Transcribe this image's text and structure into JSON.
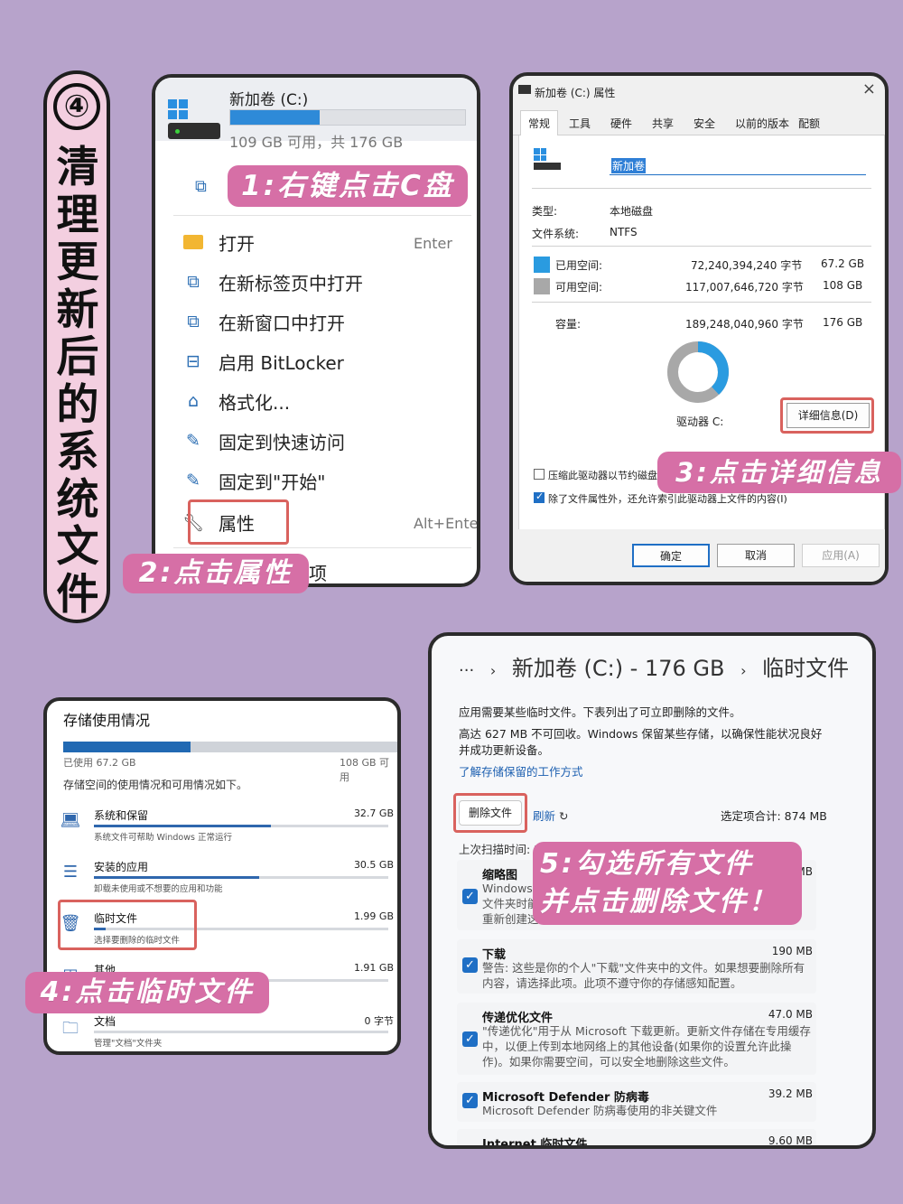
{
  "title": {
    "number": "④",
    "text": "清理更新后的系统文件"
  },
  "context_menu": {
    "drive_name": "新加卷 (C:)",
    "drive_free": "109 GB 可用，共 176 GB",
    "drive_used_fraction": 0.38,
    "items": [
      {
        "label": "打开",
        "shortcut": "Enter",
        "icon": "folder-icon"
      },
      {
        "label": "在新标签页中打开",
        "shortcut": "",
        "icon": "new-tab-icon"
      },
      {
        "label": "在新窗口中打开",
        "shortcut": "",
        "icon": "new-window-icon"
      },
      {
        "label": "启用 BitLocker",
        "shortcut": "",
        "icon": "bitlocker-icon"
      },
      {
        "label": "格式化...",
        "shortcut": "",
        "icon": "format-icon"
      },
      {
        "label": "固定到快速访问",
        "shortcut": "",
        "icon": "pin-icon"
      },
      {
        "label": "固定到\"开始\"",
        "shortcut": "",
        "icon": "pin-start-icon"
      },
      {
        "label": "属性",
        "shortcut": "Alt+Enter",
        "icon": "wrench-icon"
      },
      {
        "label": "项",
        "shortcut": "",
        "icon": ""
      }
    ]
  },
  "callouts": {
    "step1": "1:右键点击C盘",
    "step2": "2:点击属性",
    "step3": "3:点击详细信息",
    "step4": "4:点击临时文件",
    "step5_line1": "5:勾选所有文件",
    "step5_line2": "并点击删除文件！"
  },
  "properties": {
    "window_title": "新加卷 (C:) 属性",
    "close": "×",
    "tabs": [
      "常规",
      "工具",
      "硬件",
      "共享",
      "安全",
      "以前的版本",
      "配额"
    ],
    "volume_name": "新加卷",
    "type_label": "类型:",
    "type_value": "本地磁盘",
    "fs_label": "文件系统:",
    "fs_value": "NTFS",
    "used_label": "已用空间:",
    "used_bytes": "72,240,394,240 字节",
    "used_gb": "67.2 GB",
    "free_label": "可用空间:",
    "free_bytes": "117,007,646,720 字节",
    "free_gb": "108 GB",
    "cap_label": "容量:",
    "cap_bytes": "189,248,040,960 字节",
    "cap_gb": "176 GB",
    "drive_label": "驱动器 C:",
    "details_button": "详细信息(D)",
    "compress_label": "压缩此驱动器以节约磁盘",
    "index_label": "除了文件属性外，还允许索引此驱动器上文件的内容(I)",
    "ok": "确定",
    "cancel": "取消",
    "apply": "应用(A)",
    "used_color": "#2a9be0",
    "free_color": "#a8a8a8",
    "used_fraction": 0.38
  },
  "storage": {
    "title": "存储使用情况",
    "used": "已使用 67.2 GB",
    "free": "108 GB 可用",
    "used_fraction": 0.38,
    "desc": "存储空间的使用情况和可用情况如下。",
    "rows": [
      {
        "name": "系统和保留",
        "size": "32.7 GB",
        "desc": "系统文件可帮助 Windows 正常运行",
        "fraction": 0.6,
        "icon": "laptop-icon"
      },
      {
        "name": "安装的应用",
        "size": "30.5 GB",
        "desc": "卸载未使用或不想要的应用和功能",
        "fraction": 0.56,
        "icon": "apps-list-icon"
      },
      {
        "name": "临时文件",
        "size": "1.99 GB",
        "desc": "选择要删除的临时文件",
        "fraction": 0.04,
        "icon": "trash-icon"
      },
      {
        "name": "其他",
        "size": "1.91 GB",
        "desc": "",
        "fraction": 0.035,
        "icon": "other-icon"
      },
      {
        "name": "文档",
        "size": "0 字节",
        "desc": "管理\"文档\"文件夹",
        "fraction": 0,
        "icon": "documents-icon"
      }
    ]
  },
  "temp_files": {
    "breadcrumb_more": "···",
    "breadcrumb_drive": "新加卷 (C:) - 176 GB",
    "breadcrumb_page": "临时文件",
    "intro": "应用需要某些临时文件。下表列出了可立即删除的文件。",
    "reserved_line1": "高达 627 MB 不可回收。Windows 保留某些存储，以确保性能状况良好",
    "reserved_line2": "并成功更新设备。",
    "learn_link": "了解存储保留的工作方式",
    "delete_button": "删除文件",
    "refresh": "刷新",
    "selected_total": "选定项合计: 874 MB",
    "last_scan": "上次扫描时间: 2024/1/15 17:27",
    "items": [
      {
        "name": "缩略图",
        "size": "MB",
        "desc": "Windows 保留所有图片、视频和文档缩略图的副本，以便在打开文件夹时能快速显示。如果删除这些缩略图，将根据需要重新创建这些缩略图。",
        "desc_visible": "Windows\n文件夹时能\n重新创建这",
        "checked": true
      },
      {
        "name": "下载",
        "size": "190 MB",
        "desc": "警告: 这些是你的个人\"下载\"文件夹中的文件。如果想要删除所有内容，请选择此项。此项不遵守你的存储感知配置。",
        "checked": true
      },
      {
        "name": "传递优化文件",
        "size": "47.0 MB",
        "desc": "\"传递优化\"用于从 Microsoft 下载更新。更新文件存储在专用缓存中，以便上传到本地网络上的其他设备(如果你的设置允许此操作)。如果你需要空间，可以安全地删除这些文件。",
        "checked": true
      },
      {
        "name": "Microsoft Defender 防病毒",
        "size": "39.2 MB",
        "desc": "Microsoft Defender 防病毒使用的非关键文件",
        "checked": true
      },
      {
        "name": "Internet 临时文件",
        "size": "9.60 MB",
        "desc": "",
        "checked": true
      }
    ]
  }
}
